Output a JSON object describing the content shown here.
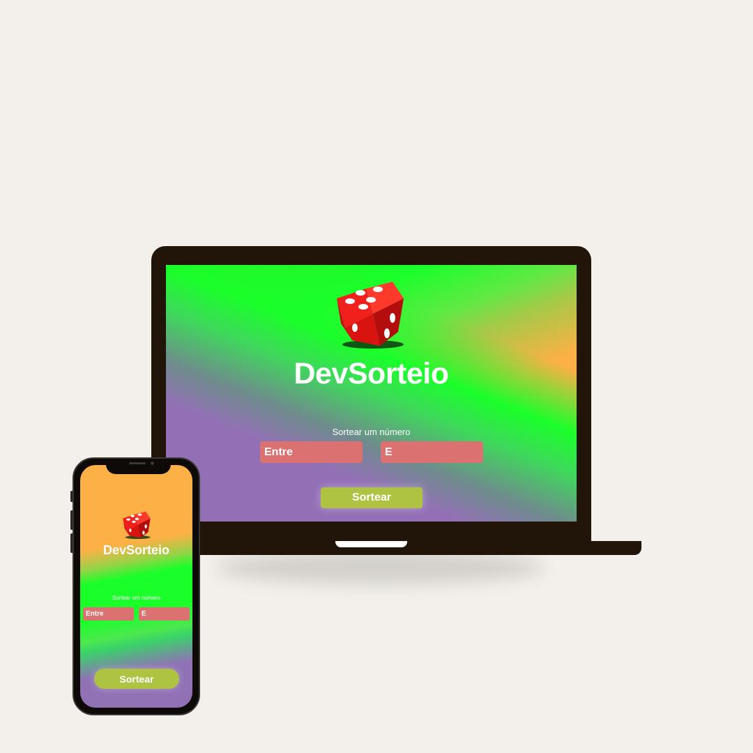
{
  "app": {
    "title": "DevSorteio",
    "label": "Sortear um número",
    "input_from_placeholder": "Entre",
    "input_to_placeholder": "E",
    "button_label": "Sortear"
  },
  "icons": {
    "logo": "dice-icon"
  },
  "colors": {
    "background": "#f3f0eb",
    "device_frame": "#211509",
    "input_background": "#db7171",
    "button_background": "#aec342",
    "gradient_green": "#1aff2a",
    "gradient_orange": "#fdb045",
    "gradient_purple": "#9370b6",
    "dice_red": "#e3140f"
  }
}
